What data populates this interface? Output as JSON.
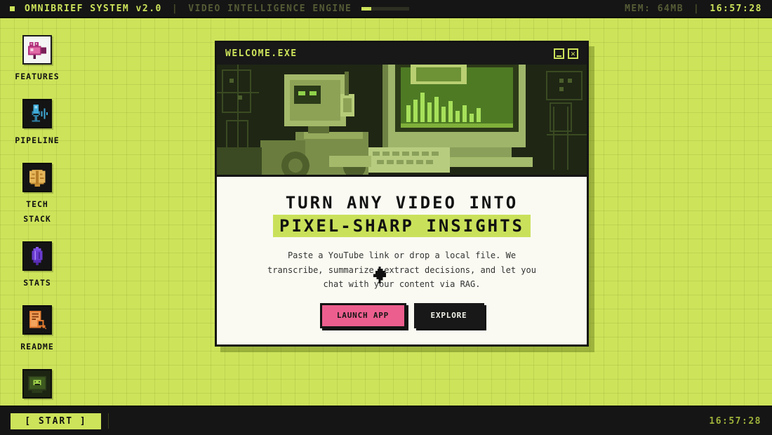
{
  "topbar": {
    "title": "OMNIBRIEF SYSTEM v2.0",
    "separator": "|",
    "subtitle": "VIDEO INTELLIGENCE ENGINE",
    "progress": 0.2,
    "memory": "MEM: 64MB",
    "clock": "16:57:28"
  },
  "desktop": {
    "icons": [
      {
        "label": "FEATURES",
        "icon": "video-camera-icon"
      },
      {
        "label": "PIPELINE",
        "icon": "microphone-waveform-icon"
      },
      {
        "label": "TECH STACK",
        "icon": "brain-icon"
      },
      {
        "label": "STATS",
        "icon": "crystal-icon"
      },
      {
        "label": "README",
        "icon": "document-magnifier-icon"
      },
      {
        "label": "",
        "icon": "terminal-icon"
      }
    ]
  },
  "window": {
    "title": "WELCOME.EXE",
    "minimize_glyph": "_",
    "close_glyph": "✕",
    "headline_line1": "TURN ANY VIDEO INTO",
    "headline_line2": "PIXEL-SHARP INSIGHTS",
    "description": "Paste a YouTube link or drop a local file. We transcribe, summarize, extract decisions, and let you chat with your content via RAG.",
    "primary_button": "LAUNCH APP",
    "secondary_button": "EXPLORE"
  },
  "taskbar": {
    "start_label": "[ START ]",
    "clock": "16:57:28"
  },
  "colors": {
    "desktop": "#cde35a",
    "bar": "#151515",
    "accent": "#cde35a",
    "primary_button": "#ec5e8e",
    "highlight": "#c9e15a"
  }
}
